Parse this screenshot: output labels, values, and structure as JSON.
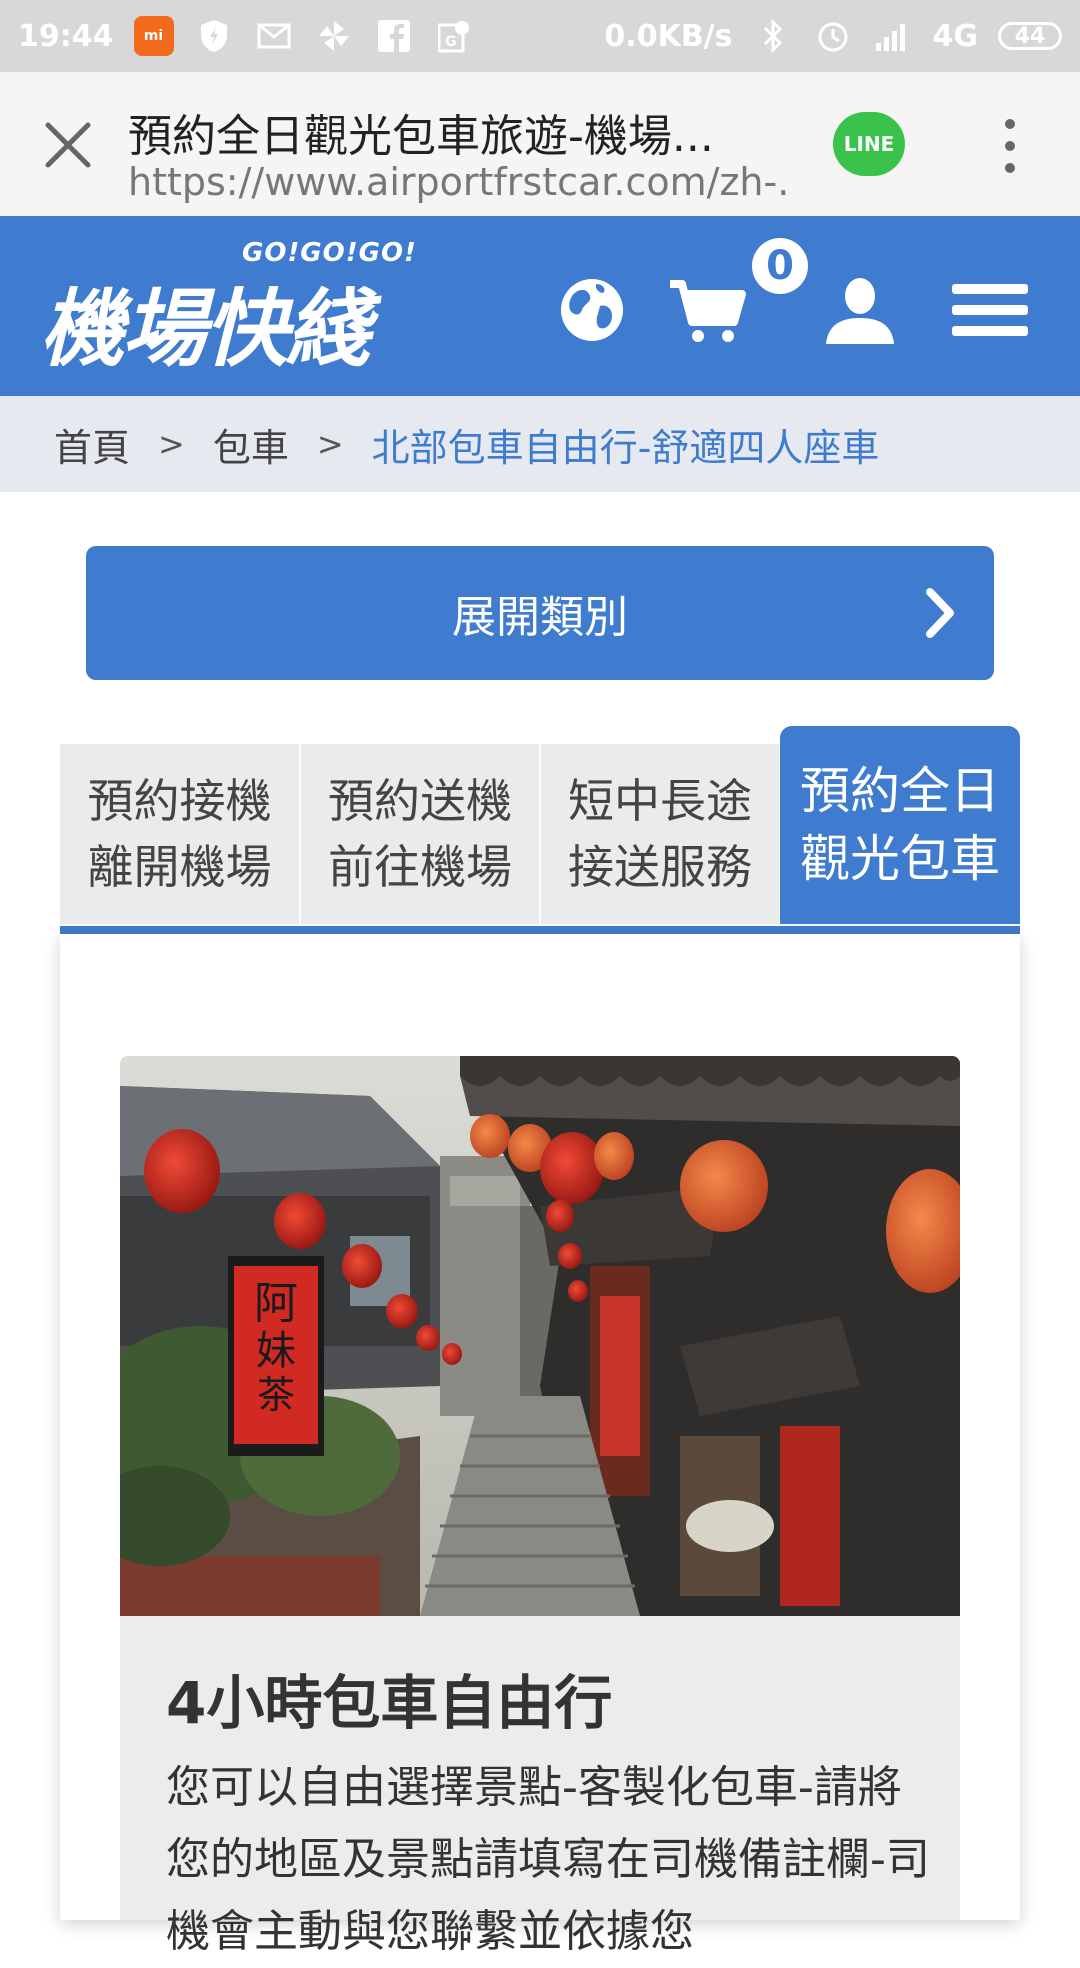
{
  "status_bar": {
    "time": "19:44",
    "network_speed": "0.0KB/s",
    "signal": "4G",
    "battery": "44",
    "left_icons": [
      "mi-icon",
      "shield-icon",
      "mail-icon",
      "pinwheel-icon",
      "facebook-icon",
      "maps-icon"
    ],
    "right_icons": [
      "bluetooth-icon",
      "alarm-icon",
      "signal-icon"
    ]
  },
  "browser": {
    "title": "預約全日觀光包車旅遊-機場...",
    "url": "https://www.airportfrstcar.com/zh-...",
    "line_label": "LINE"
  },
  "header": {
    "logo_subtitle": "GO!GO!GO!",
    "logo_text": "機場快綫",
    "cart_count": "0",
    "icons": [
      "globe-icon",
      "cart-icon",
      "user-icon",
      "menu-icon"
    ]
  },
  "breadcrumb": {
    "items": [
      "首頁",
      "包車",
      "北部包車自由行-舒適四人座車"
    ],
    "separator": ">"
  },
  "expand_button": {
    "label": "展開類別"
  },
  "tabs": [
    {
      "line1": "預約接機",
      "line2": "離開機場",
      "active": false
    },
    {
      "line1": "預約送機",
      "line2": "前往機場",
      "active": false
    },
    {
      "line1": "短中長途",
      "line2": "接送服務",
      "active": false
    },
    {
      "line1": "預約全日",
      "line2": "觀光包車",
      "active": true
    }
  ],
  "card": {
    "title": "4小時包車自由行",
    "description": "您可以自由選擇景點-客製化包車-請將您的地區及景點請填寫在司機備註欄-司機會主動與您聯繫並依據您",
    "image_alt": "紅燈籠老街階梯"
  },
  "colors": {
    "primary": "#3f7ccf",
    "breadcrumb_bg": "#e6eaf0",
    "tab_bg": "#ebebeb",
    "status_bar_bg": "#d8d8d8",
    "line_green": "#3ac34a"
  }
}
